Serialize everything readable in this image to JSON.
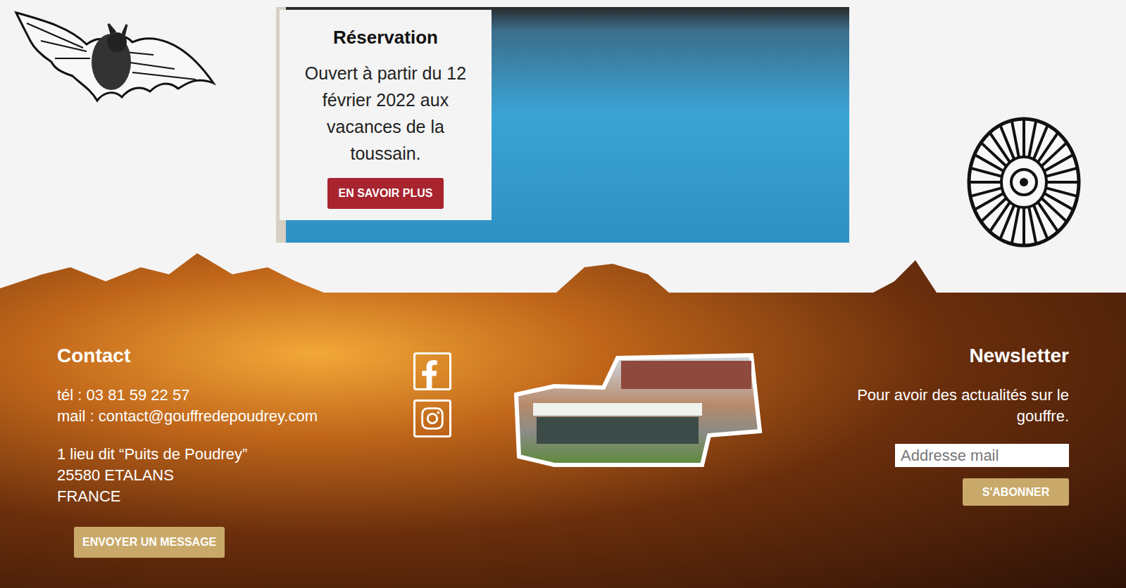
{
  "reservation": {
    "title": "Réservation",
    "text": "Ouvert à partir du 12 février 2022 aux vacances de la toussain.",
    "button": "EN SAVOIR PLUS"
  },
  "contact": {
    "title": "Contact",
    "lines": [
      "tél : 03 81 59 22 57",
      "mail : contact@gouffredepoudrey.com"
    ],
    "address": [
      "1 lieu dit “Puits de Poudrey”",
      "25580 ETALANS",
      "FRANCE"
    ],
    "button": "ENVOYER UN MESSAGE"
  },
  "newsletter": {
    "title": "Newsletter",
    "text": "Pour avoir des actualités sur le gouffre.",
    "placeholder": "Addresse mail",
    "button": "S'ABONNER"
  }
}
